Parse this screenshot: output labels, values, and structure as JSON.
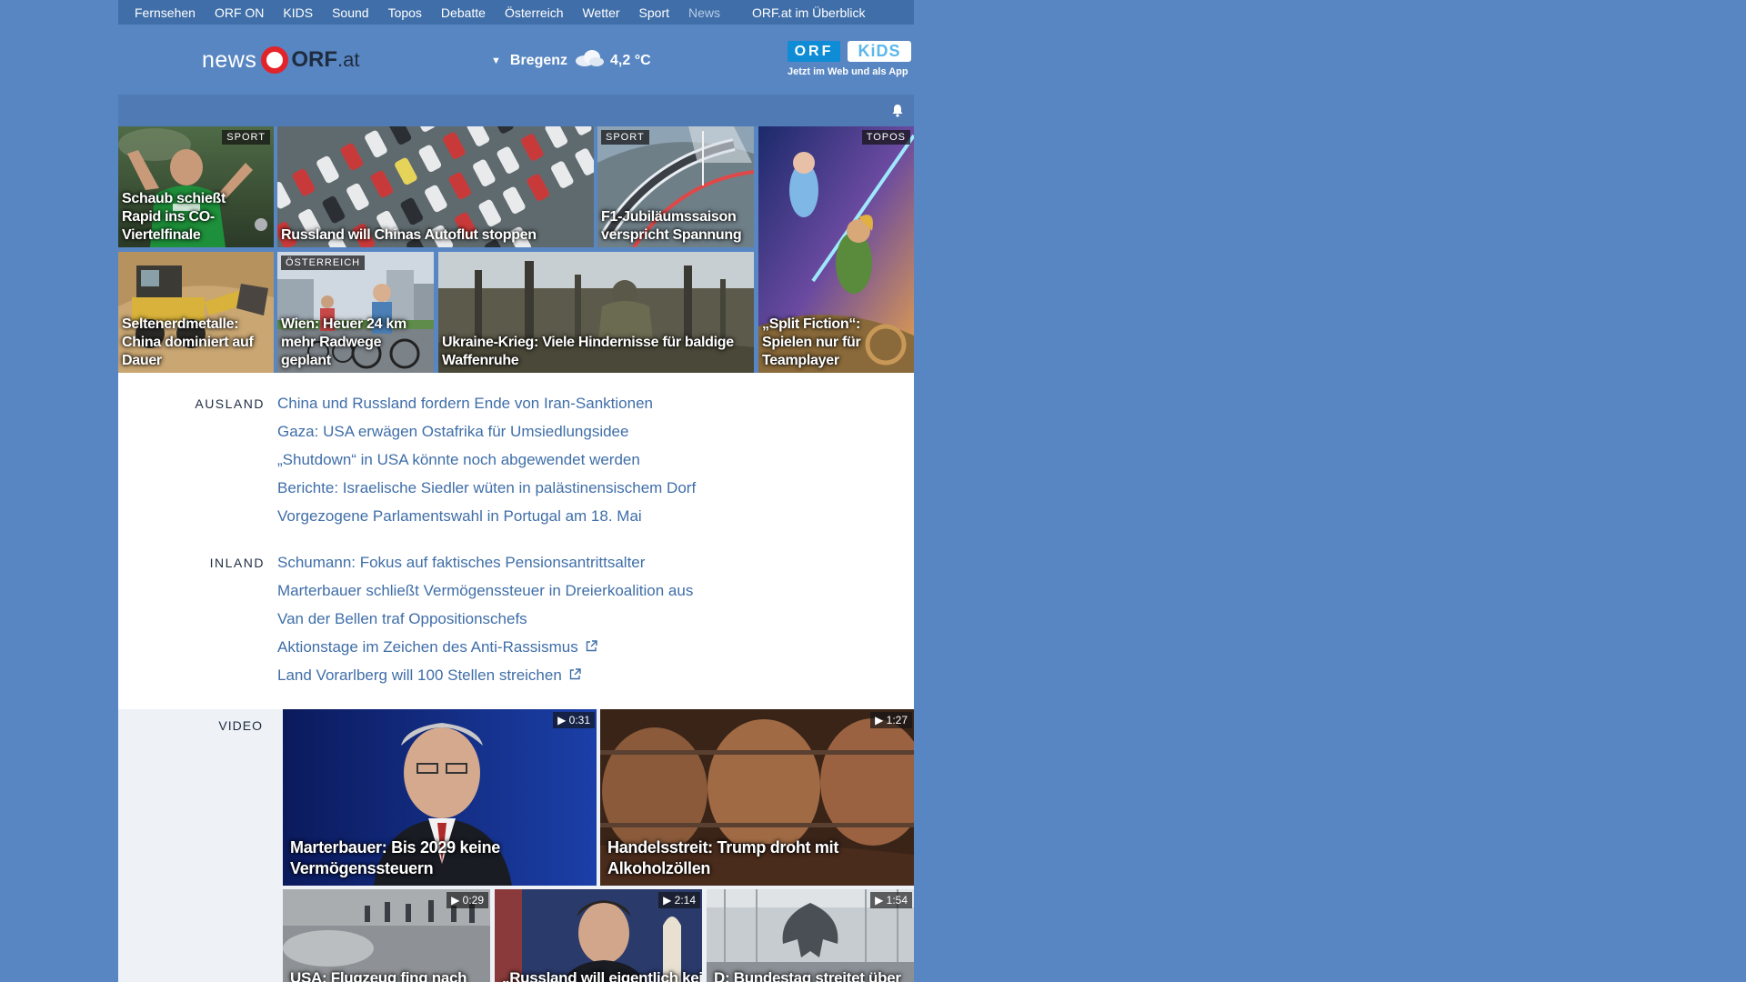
{
  "topnav": {
    "items": [
      "Fernsehen",
      "ORF ON",
      "KIDS",
      "Sound",
      "Topos",
      "Debatte",
      "Österreich",
      "Wetter",
      "Sport",
      "News"
    ],
    "overview": "ORF.at im Überblick"
  },
  "header": {
    "logo_news": "news",
    "logo_orf": "ORF",
    "logo_at": ".at",
    "weather_city": "Bregenz",
    "weather_temp": "4,2 °C",
    "kids_orf": "ORF",
    "kids_kids": "KiDS",
    "kids_tagline": "Jetzt im Web und als App"
  },
  "tiles": [
    {
      "badge": "SPORT",
      "caption": "Schaub schießt Rapid ins CO-Viertelfinale"
    },
    {
      "badge": "",
      "caption": "Russland will Chinas Autoflut stoppen"
    },
    {
      "badge": "SPORT",
      "caption": "F1-Jubiläumssaison verspricht Spannung"
    },
    {
      "badge": "TOPOS",
      "caption": "„Split Fiction“: Spielen nur für Teamplayer"
    },
    {
      "badge": "",
      "caption": "Seltenerdmetalle: China dominiert auf Dauer"
    },
    {
      "badge": "ÖSTERREICH",
      "caption": "Wien: Heuer 24 km mehr Radwege geplant"
    },
    {
      "badge": "",
      "caption": "Ukraine-Krieg: Viele Hindernisse für baldige Waffenruhe"
    }
  ],
  "ausland": {
    "label": "AUSLAND",
    "items": [
      "China und Russland fordern Ende von Iran-Sanktionen",
      "Gaza: USA erwägen Ostafrika für Umsiedlungsidee",
      "„Shutdown“ in USA könnte noch abgewendet werden",
      "Berichte: Israelische Siedler wüten in palästinensischem Dorf",
      "Vorgezogene Parlamentswahl in Portugal am 18. Mai"
    ]
  },
  "inland": {
    "label": "INLAND",
    "items": [
      "Schumann: Fokus auf faktisches Pensionsantrittsalter",
      "Marterbauer schließt Vermögenssteuer in Dreierkoalition aus",
      "Van der Bellen traf Oppositionschefs",
      "Aktionstage im Zeichen des Anti-Rassismus",
      "Land Vorarlberg will 100 Stellen streichen"
    ]
  },
  "video": {
    "label": "VIDEO",
    "items": [
      {
        "duration": "0:31",
        "caption": "Marterbauer: Bis 2029 keine Vermögenssteuern"
      },
      {
        "duration": "1:27",
        "caption": "Handelsstreit: Trump droht mit Alkoholzöllen"
      },
      {
        "duration": "0:29",
        "caption": "USA: Flugzeug fing nach"
      },
      {
        "duration": "2:14",
        "caption": "„Russland will eigentlich keine"
      },
      {
        "duration": "1:54",
        "caption": "D: Bundestag streitet über"
      }
    ]
  },
  "colors": {
    "page_bg": "#5886c2",
    "topnav_bg": "#3f6ea8",
    "link": "#3f6ea8",
    "orf_red": "#e2232a"
  }
}
